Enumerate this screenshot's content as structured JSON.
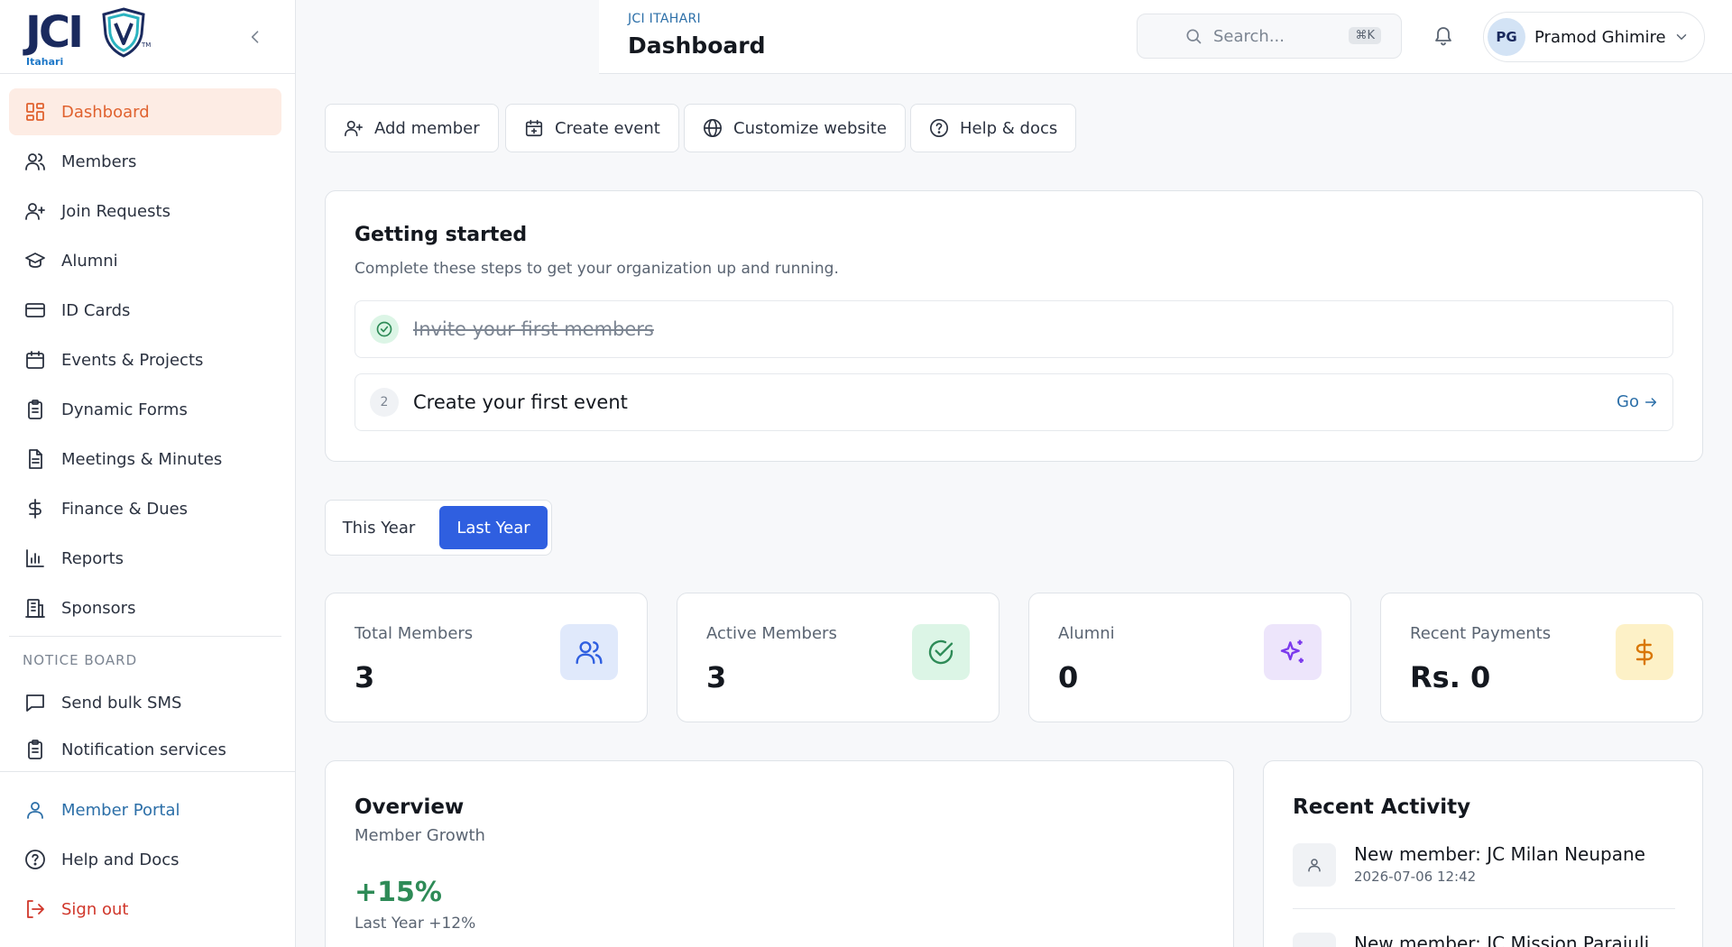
{
  "sidebar": {
    "logo": {
      "text": "JCI",
      "tm": "TM",
      "sub": "Itahari"
    },
    "items": [
      {
        "label": "Dashboard",
        "icon": "dashboard-icon"
      },
      {
        "label": "Members",
        "icon": "users-icon"
      },
      {
        "label": "Join Requests",
        "icon": "user-plus-icon"
      },
      {
        "label": "Alumni",
        "icon": "graduation-cap-icon"
      },
      {
        "label": "ID Cards",
        "icon": "id-card-icon"
      },
      {
        "label": "Events & Projects",
        "icon": "calendar-icon"
      },
      {
        "label": "Dynamic Forms",
        "icon": "clipboard-icon"
      },
      {
        "label": "Meetings & Minutes",
        "icon": "document-icon"
      },
      {
        "label": "Finance & Dues",
        "icon": "dollar-icon"
      },
      {
        "label": "Reports",
        "icon": "bar-chart-icon"
      },
      {
        "label": "Sponsors",
        "icon": "building-icon"
      }
    ],
    "notice_board": {
      "label": "NOTICE BOARD",
      "items": [
        {
          "label": "Send bulk SMS",
          "icon": "message-icon"
        },
        {
          "label": "Notification services",
          "icon": "clipboard-icon"
        }
      ]
    },
    "footer": [
      {
        "label": "Member Portal",
        "icon": "user-icon"
      },
      {
        "label": "Help and Docs",
        "icon": "help-circle-icon"
      },
      {
        "label": "Sign out",
        "icon": "logout-icon"
      }
    ]
  },
  "header": {
    "org": "JCI ITAHARI",
    "title": "Dashboard",
    "search": {
      "placeholder": "Search...",
      "shortcut": "⌘K"
    },
    "user": {
      "initials": "PG",
      "name": "Pramod Ghimire"
    }
  },
  "quick_actions": [
    {
      "label": "Add member",
      "icon": "user-plus-icon"
    },
    {
      "label": "Create event",
      "icon": "calendar-plus-icon"
    },
    {
      "label": "Customize website",
      "icon": "globe-icon"
    },
    {
      "label": "Help & docs",
      "icon": "help-circle-icon"
    }
  ],
  "getting_started": {
    "title": "Getting started",
    "subtitle": "Complete these steps to get your organization up and running.",
    "steps": [
      {
        "label": "Invite your first members",
        "done": true
      },
      {
        "number": "2",
        "label": "Create your first event",
        "done": false,
        "action": "Go"
      }
    ]
  },
  "year_toggle": {
    "options": [
      "This Year",
      "Last Year"
    ],
    "selected": "Last Year"
  },
  "stats": [
    {
      "label": "Total Members",
      "value": "3",
      "icon": "users-icon",
      "color": "#2f5fe0"
    },
    {
      "label": "Active Members",
      "value": "3",
      "icon": "check-circle-icon",
      "color": "#2e8b57"
    },
    {
      "label": "Alumni",
      "value": "0",
      "icon": "sparkles-icon",
      "color": "#7c3aed"
    },
    {
      "label": "Recent Payments",
      "value": "Rs. 0",
      "icon": "dollar-icon",
      "color": "#d97706"
    }
  ],
  "overview": {
    "title": "Overview",
    "subtitle": "Member Growth",
    "growth": "+15%",
    "comparison": "Last Year +12%"
  },
  "recent_activity": {
    "title": "Recent Activity",
    "items": [
      {
        "text": "New member: JC Milan Neupane",
        "time": "2026-07-06 12:42"
      },
      {
        "text": "New member: JC Mission Parajuli",
        "time": ""
      }
    ]
  },
  "colors": {
    "accent": "#e0622f",
    "primary": "#2f5fe0",
    "link": "#2c6fa8",
    "danger": "#d0362a"
  }
}
